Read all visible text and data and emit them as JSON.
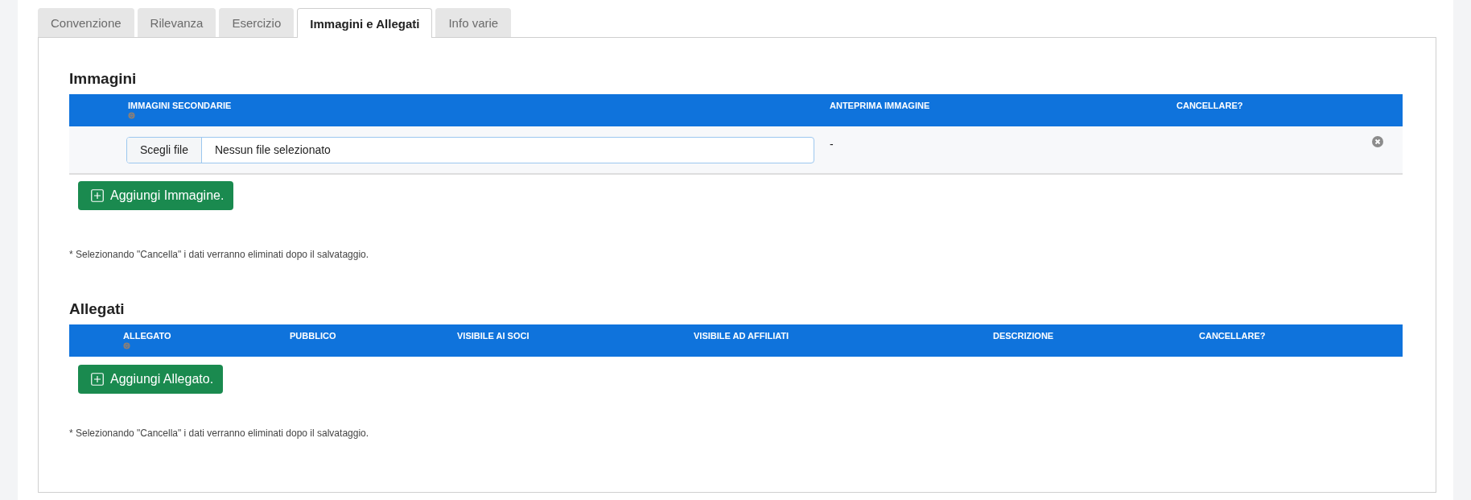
{
  "tabs": [
    {
      "label": "Convenzione",
      "selected": false
    },
    {
      "label": "Rilevanza",
      "selected": false
    },
    {
      "label": "Esercizio",
      "selected": false
    },
    {
      "label": "Immagini e Allegati",
      "selected": true
    },
    {
      "label": "Info varie",
      "selected": false
    }
  ],
  "sections": [
    {
      "title": "Immagini",
      "columns": [
        "IMMAGINI SECONDARIE",
        "ANTEPRIMA IMMAGINE",
        "CANCELLARE?"
      ],
      "rows": [
        {
          "file_button": "Scegli file",
          "file_value": "Nessun file selezionato",
          "preview": "-"
        }
      ],
      "add_button": "Aggiungi Immagine.",
      "note": "* Selezionando \"Cancella\" i dati verranno eliminati dopo il salvataggio."
    },
    {
      "title": "Allegati",
      "columns": [
        "ALLEGATO",
        "PUBBLICO",
        "VISIBILE AI SOCI",
        "VISIBILE AD AFFILIATI",
        "DESCRIZIONE",
        "CANCELLARE?"
      ],
      "add_button": "Aggiungi Allegato.",
      "note": "* Selezionando \"Cancella\" i dati verranno eliminati dopo il salvataggio."
    }
  ]
}
